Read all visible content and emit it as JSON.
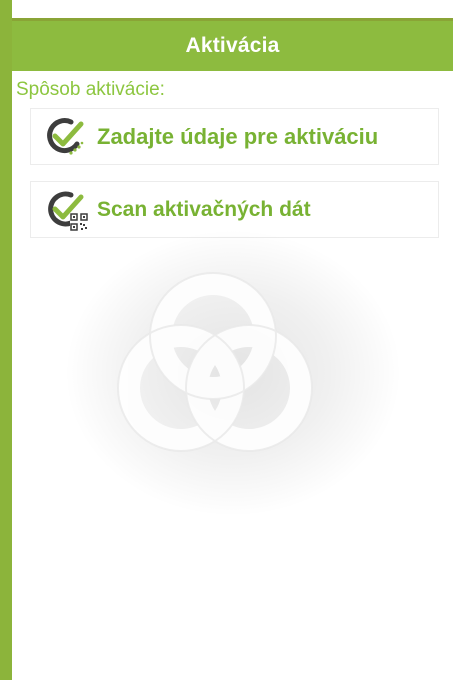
{
  "header": {
    "title": "Aktivácia"
  },
  "section": {
    "label": "Spôsob aktivácie:"
  },
  "options": [
    {
      "label": "Zadajte údaje pre aktiváciu",
      "icon": "check-circle-icon"
    },
    {
      "label": "Scan aktivačných dát",
      "icon": "check-qr-icon"
    }
  ],
  "colors": {
    "accent": "#8dbb3f",
    "text_green": "#78b233",
    "icon_dark": "#3d3d3d"
  }
}
